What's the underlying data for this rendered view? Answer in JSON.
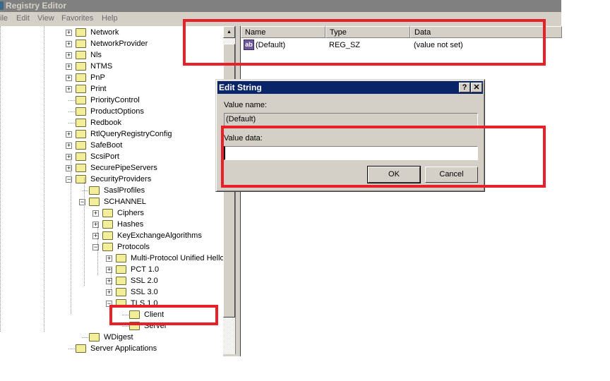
{
  "window": {
    "title": "Registry Editor"
  },
  "menu": [
    "ile",
    "Edit",
    "View",
    "Favorites",
    "Help"
  ],
  "tree": [
    {
      "label": "Network",
      "level": 0,
      "expander": "plus"
    },
    {
      "label": "NetworkProvider",
      "level": 0,
      "expander": "plus"
    },
    {
      "label": "Nls",
      "level": 0,
      "expander": "plus"
    },
    {
      "label": "NTMS",
      "level": 0,
      "expander": "plus"
    },
    {
      "label": "PnP",
      "level": 0,
      "expander": "plus"
    },
    {
      "label": "Print",
      "level": 0,
      "expander": "plus"
    },
    {
      "label": "PriorityControl",
      "level": 0,
      "expander": "none"
    },
    {
      "label": "ProductOptions",
      "level": 0,
      "expander": "none"
    },
    {
      "label": "Redbook",
      "level": 0,
      "expander": "none"
    },
    {
      "label": "RtlQueryRegistryConfig",
      "level": 0,
      "expander": "plus"
    },
    {
      "label": "SafeBoot",
      "level": 0,
      "expander": "plus"
    },
    {
      "label": "ScsiPort",
      "level": 0,
      "expander": "plus"
    },
    {
      "label": "SecurePipeServers",
      "level": 0,
      "expander": "plus"
    },
    {
      "label": "SecurityProviders",
      "level": 0,
      "expander": "minus"
    },
    {
      "label": "SaslProfiles",
      "level": 1,
      "expander": "none"
    },
    {
      "label": "SCHANNEL",
      "level": 1,
      "expander": "minus"
    },
    {
      "label": "Ciphers",
      "level": 2,
      "expander": "plus"
    },
    {
      "label": "Hashes",
      "level": 2,
      "expander": "plus"
    },
    {
      "label": "KeyExchangeAlgorithms",
      "level": 2,
      "expander": "plus"
    },
    {
      "label": "Protocols",
      "level": 2,
      "expander": "minus"
    },
    {
      "label": "Multi-Protocol Unified Hello",
      "level": 3,
      "expander": "plus"
    },
    {
      "label": "PCT 1.0",
      "level": 3,
      "expander": "plus"
    },
    {
      "label": "SSL 2.0",
      "level": 3,
      "expander": "plus"
    },
    {
      "label": "SSL 3.0",
      "level": 3,
      "expander": "plus"
    },
    {
      "label": "TLS 1.0",
      "level": 3,
      "expander": "minus"
    },
    {
      "label": "Client",
      "level": 4,
      "expander": "none",
      "selected": true
    },
    {
      "label": "Server",
      "level": 4,
      "expander": "none"
    },
    {
      "label": "WDigest",
      "level": 1,
      "expander": "none"
    },
    {
      "label": "Server Applications",
      "level": 0,
      "expander": "none"
    }
  ],
  "list": {
    "columns": [
      "Name",
      "Type",
      "Data"
    ],
    "rows": [
      {
        "name": "(Default)",
        "type": "REG_SZ",
        "data": "(value not set)",
        "icon": "string-value-icon"
      }
    ]
  },
  "dialog": {
    "title": "Edit String",
    "help_label": "?",
    "close_label": "✕",
    "value_name_label": "Value name:",
    "value_name": "(Default)",
    "value_data_label": "Value data:",
    "value_data": "",
    "ok_label": "OK",
    "cancel_label": "Cancel"
  },
  "annotation_color": "#e8202a"
}
